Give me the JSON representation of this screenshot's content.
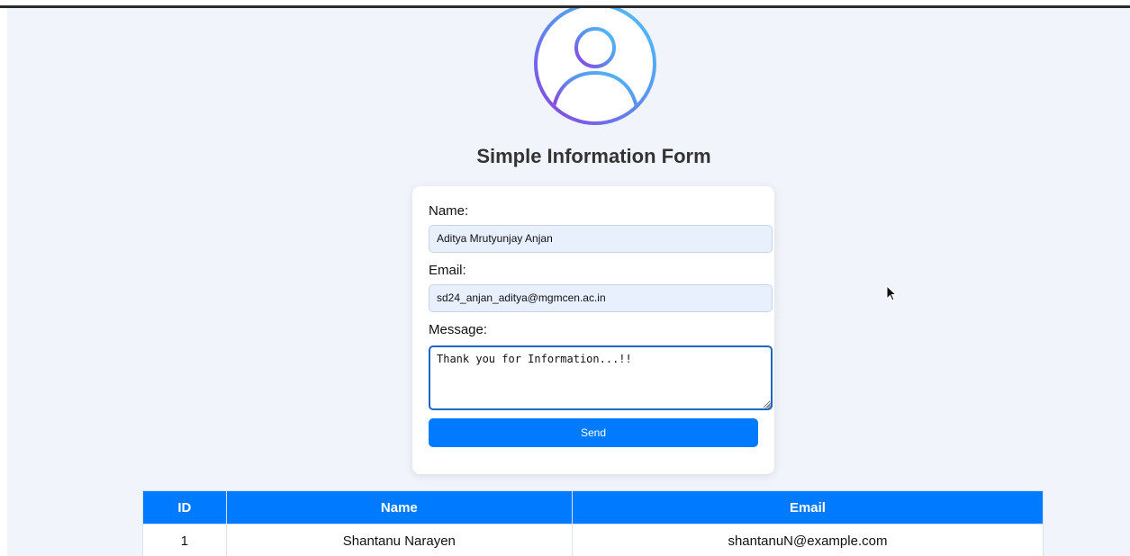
{
  "page": {
    "title": "Simple Information Form",
    "avatar_icon": "user-profile-icon"
  },
  "form": {
    "name": {
      "label": "Name:",
      "value": "Aditya Mrutyunjay Anjan"
    },
    "email": {
      "label": "Email:",
      "value": "sd24_anjan_aditya@mgmcen.ac.in"
    },
    "message": {
      "label": "Message:",
      "value": "Thank you for Information...!!"
    },
    "send_label": "Send"
  },
  "table": {
    "headers": {
      "id": "ID",
      "name": "Name",
      "email": "Email"
    },
    "rows": [
      {
        "id": "1",
        "name": "Shantanu Narayen",
        "email": "shantanuN@example.com"
      }
    ]
  },
  "colors": {
    "accent": "#007bff",
    "background": "#f1f5fb",
    "input_fill": "#e8f0fe",
    "focus_border": "#1a66c9"
  }
}
